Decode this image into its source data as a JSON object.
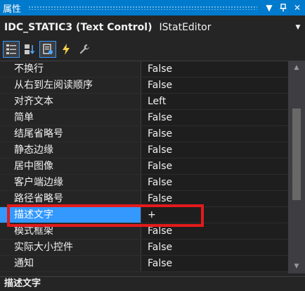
{
  "window": {
    "title": "属性",
    "pin_glyph": "↑",
    "close_glyph": "✕",
    "dropdown_glyph": "▼"
  },
  "object_selector": {
    "name": "IDC_STATIC3 (Text Control)",
    "type": "IStatEditor",
    "dropdown_glyph": "▼"
  },
  "toolbar": {
    "tools": [
      {
        "icon": "categorized-icon",
        "active": true
      },
      {
        "icon": "alphabetical-icon",
        "active": false
      },
      {
        "icon": "properties-icon",
        "active": true
      },
      {
        "icon": "events-icon",
        "active": false
      },
      {
        "icon": "wrench-icon",
        "active": false
      }
    ]
  },
  "properties": [
    {
      "name": "不换行",
      "value": "False"
    },
    {
      "name": "从右到左阅读顺序",
      "value": "False"
    },
    {
      "name": "对齐文本",
      "value": "Left"
    },
    {
      "name": "简单",
      "value": "False"
    },
    {
      "name": "结尾省略号",
      "value": "False"
    },
    {
      "name": "静态边缘",
      "value": "False"
    },
    {
      "name": "居中图像",
      "value": "False"
    },
    {
      "name": "客户端边缘",
      "value": "False"
    },
    {
      "name": "路径省略号",
      "value": "False"
    },
    {
      "name": "描述文字",
      "value": "+",
      "selected": true
    },
    {
      "name": "模式框架",
      "value": "False"
    },
    {
      "name": "实际大小控件",
      "value": "False"
    },
    {
      "name": "通知",
      "value": "False"
    }
  ],
  "scrollbar": {
    "up_glyph": "▲",
    "down_glyph": "▼"
  },
  "description": {
    "title": "描述文字"
  },
  "colors": {
    "accent": "#007acc",
    "selection": "#3399ff",
    "highlight_box": "#e31a1c"
  }
}
